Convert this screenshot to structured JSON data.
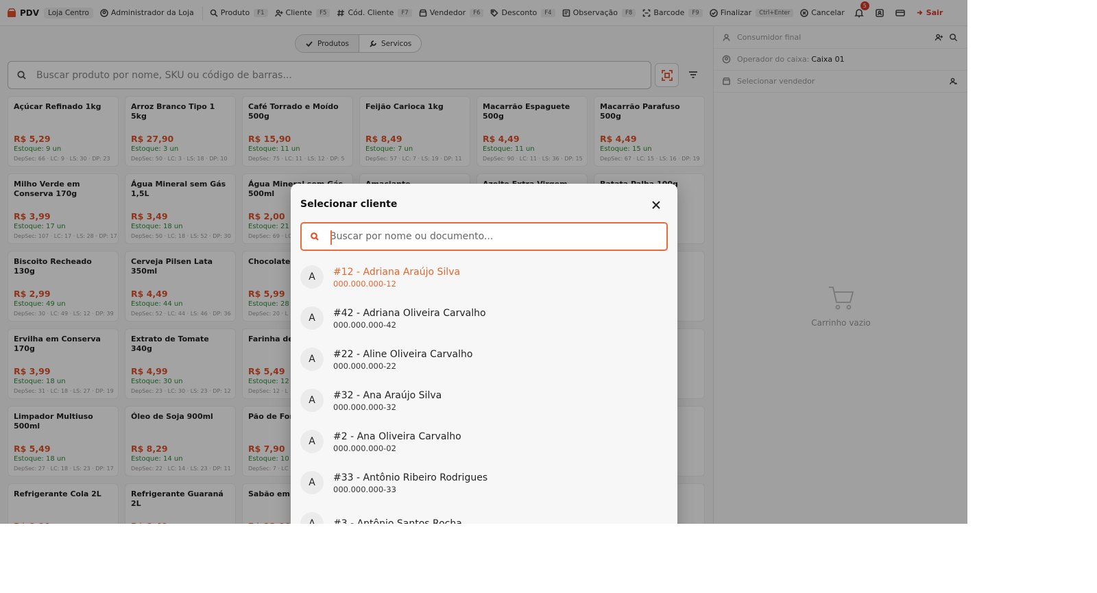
{
  "topbar": {
    "brand": "PDV",
    "store": "Loja Centro",
    "user": "Administrador da Loja",
    "actions": [
      {
        "label": "Produto",
        "key": "F1",
        "icon": "search-icon"
      },
      {
        "label": "Cliente",
        "key": "F5",
        "icon": "user-add-icon"
      },
      {
        "label": "Cód. Cliente",
        "key": "F7",
        "icon": "hash-icon"
      },
      {
        "label": "Vendedor",
        "key": "F6",
        "icon": "store-icon"
      },
      {
        "label": "Desconto",
        "key": "F4",
        "icon": "tag-icon"
      },
      {
        "label": "Observação",
        "key": "F8",
        "icon": "note-icon"
      },
      {
        "label": "Barcode",
        "key": "F9",
        "icon": "barcode-scan-icon"
      },
      {
        "label": "Finalizar",
        "key": "Ctrl+Enter",
        "icon": "check-circle-icon"
      }
    ],
    "cancel_label": "Cancelar",
    "notifications_count": "5",
    "exit_label": "Sair"
  },
  "tabs": {
    "products": "Produtos",
    "services": "Servicos"
  },
  "search": {
    "placeholder": "Buscar produto por nome, SKU ou código de barras..."
  },
  "products": [
    {
      "name": "Açúcar Refinado 1kg",
      "price": "R$ 5,29",
      "stock": "Estoque: 9 un",
      "dep": "DepSec: 66 · LC: 9 · LS: 30 · DP: 23"
    },
    {
      "name": "Arroz Branco Tipo 1 5kg",
      "price": "R$ 27,90",
      "stock": "Estoque: 3 un",
      "dep": "DepSec: 50 · LC: 3 · LS: 18 · DP: 10"
    },
    {
      "name": "Café Torrado e Moído 500g",
      "price": "R$ 15,90",
      "stock": "Estoque: 11 un",
      "dep": "DepSec: 75 · LC: 11 · LS: 12 · DP: 5"
    },
    {
      "name": "Feijão Carioca 1kg",
      "price": "R$ 8,49",
      "stock": "Estoque: 7 un",
      "dep": "DepSec: 57 · LC: 7 · LS: 19 · DP: 11"
    },
    {
      "name": "Macarrão Espaguete 500g",
      "price": "R$ 4,49",
      "stock": "Estoque: 11 un",
      "dep": "DepSec: 90 · LC: 11 · LS: 36 · DP: 15"
    },
    {
      "name": "Macarrão Parafuso 500g",
      "price": "R$ 4,49",
      "stock": "Estoque: 15 un",
      "dep": "DepSec: 67 · LC: 15 · LS: 16 · DP: 19"
    },
    {
      "name": "Milho Verde em Conserva 170g",
      "price": "R$ 3,99",
      "stock": "Estoque: 17 un",
      "dep": "DepSec: 107 · LC: 17 · LS: 28 · DP: 17"
    },
    {
      "name": "Água Mineral sem Gás 1,5L",
      "price": "R$ 3,49",
      "stock": "Estoque: 18 un",
      "dep": "DepSec: 50 · LC: 18 · LS: 52 · DP: 30"
    },
    {
      "name": "Água Mineral sem Gás 500ml",
      "price": "R$ 2,00",
      "stock": "Estoque: 21 un",
      "dep": "DepSec: 69 · LC:"
    },
    {
      "name": "Amaciante Concentrado 2L",
      "price": "",
      "stock": "",
      "dep": ""
    },
    {
      "name": "Azeite Extra Virgem 500ml",
      "price": "",
      "stock": "",
      "dep": ""
    },
    {
      "name": "Batata Palha 100g",
      "price": "",
      "stock": "",
      "dep": "DP: 27"
    },
    {
      "name": "Biscoito Recheado 130g",
      "price": "R$ 2,99",
      "stock": "Estoque: 49 un",
      "dep": "DepSec: 30 · LC: 49 · LS: 12 · DP: 39"
    },
    {
      "name": "Cerveja Pilsen Lata 350ml",
      "price": "R$ 4,49",
      "stock": "Estoque: 44 un",
      "dep": "DepSec: 52 · LC: 44 · LS: 46 · DP: 36"
    },
    {
      "name": "Chocolate a",
      "price": "R$ 5,99",
      "stock": "Estoque: 28",
      "dep": "DepSec: 20 · L"
    },
    {
      "name": "",
      "price": "",
      "stock": "",
      "dep": ""
    },
    {
      "name": "",
      "price": "",
      "stock": "",
      "dep": ""
    },
    {
      "name": "00ml",
      "price": "",
      "stock": "",
      "dep": "DP: 51"
    },
    {
      "name": "Ervilha em Conserva 170g",
      "price": "R$ 3,99",
      "stock": "Estoque: 18 un",
      "dep": "DepSec: 31 · LC: 18 · LS: 27 · DP: 19"
    },
    {
      "name": "Extrato de Tomate 340g",
      "price": "R$ 4,99",
      "stock": "Estoque: 30 un",
      "dep": "DepSec: 23 · LC: 30 · LS: 23 · DP: 12"
    },
    {
      "name": "Farinha de T",
      "price": "R$ 5,49",
      "stock": "Estoque: 12 u",
      "dep": "DepSec: 12 · L"
    },
    {
      "name": "",
      "price": "",
      "stock": "",
      "dep": ""
    },
    {
      "name": "",
      "price": "",
      "stock": "",
      "dep": ""
    },
    {
      "name": "",
      "price": "",
      "stock": "",
      "dep": "DP: 26"
    },
    {
      "name": "Limpador Multiuso 500ml",
      "price": "R$ 5,49",
      "stock": "Estoque: 18 un",
      "dep": "DepSec: 27 · LC: 18 · LS: 23 · DP: 17"
    },
    {
      "name": "Óleo de Soja 900ml",
      "price": "R$ 8,29",
      "stock": "Estoque: 14 un",
      "dep": "DepSec: 22 · LC: 14 · LS: 23 · DP: 11"
    },
    {
      "name": "Pão de Form 500g",
      "price": "R$ 7,90",
      "stock": "Estoque: 10",
      "dep": "DepSec: 7 · LC"
    },
    {
      "name": "",
      "price": "",
      "stock": "",
      "dep": ""
    },
    {
      "name": "",
      "price": "",
      "stock": "",
      "dep": ""
    },
    {
      "name": "ado",
      "price": "",
      "stock": "",
      "dep": "8"
    },
    {
      "name": "Refrigerante Cola 2L",
      "price": "R$ 9,99",
      "stock": "",
      "dep": ""
    },
    {
      "name": "Refrigerante Guaraná 2L",
      "price": "R$ 8,49",
      "stock": "",
      "dep": ""
    },
    {
      "name": "Sabão em P",
      "price": "R$ 12,90",
      "stock": "",
      "dep": ""
    },
    {
      "name": "",
      "price": "",
      "stock": "",
      "dep": ""
    },
    {
      "name": "",
      "price": "",
      "stock": "",
      "dep": ""
    },
    {
      "name": "g",
      "price": "",
      "stock": "",
      "dep": ""
    }
  ],
  "right_panel": {
    "customer_placeholder": "Consumidor final",
    "operator_label": "Operador do caixa:",
    "operator_value": "Caixa 01",
    "seller_placeholder": "Selecionar vendedor",
    "cart_empty": "Carrinho vazio"
  },
  "modal": {
    "title": "Selecionar cliente",
    "search_placeholder": "Buscar por nome ou documento...",
    "customers": [
      {
        "initial": "A",
        "name": "#12 - Adriana Araújo Silva",
        "doc": "000.000.000-12",
        "selected": true
      },
      {
        "initial": "A",
        "name": "#42 - Adriana Oliveira Carvalho",
        "doc": "000.000.000-42",
        "selected": false
      },
      {
        "initial": "A",
        "name": "#22 - Aline Oliveira Carvalho",
        "doc": "000.000.000-22",
        "selected": false
      },
      {
        "initial": "A",
        "name": "#32 - Ana Araújo Silva",
        "doc": "000.000.000-32",
        "selected": false
      },
      {
        "initial": "A",
        "name": "#2 - Ana Oliveira Carvalho",
        "doc": "000.000.000-02",
        "selected": false
      },
      {
        "initial": "A",
        "name": "#33 - Antônio Ribeiro Rodrigues",
        "doc": "000.000.000-33",
        "selected": false
      },
      {
        "initial": "A",
        "name": "#3 - Antônio Santos Rocha",
        "doc": "",
        "selected": false
      }
    ]
  },
  "colors": {
    "accent": "#e8642f",
    "stock_green": "#2e8b3a",
    "danger": "#d43a2a"
  }
}
